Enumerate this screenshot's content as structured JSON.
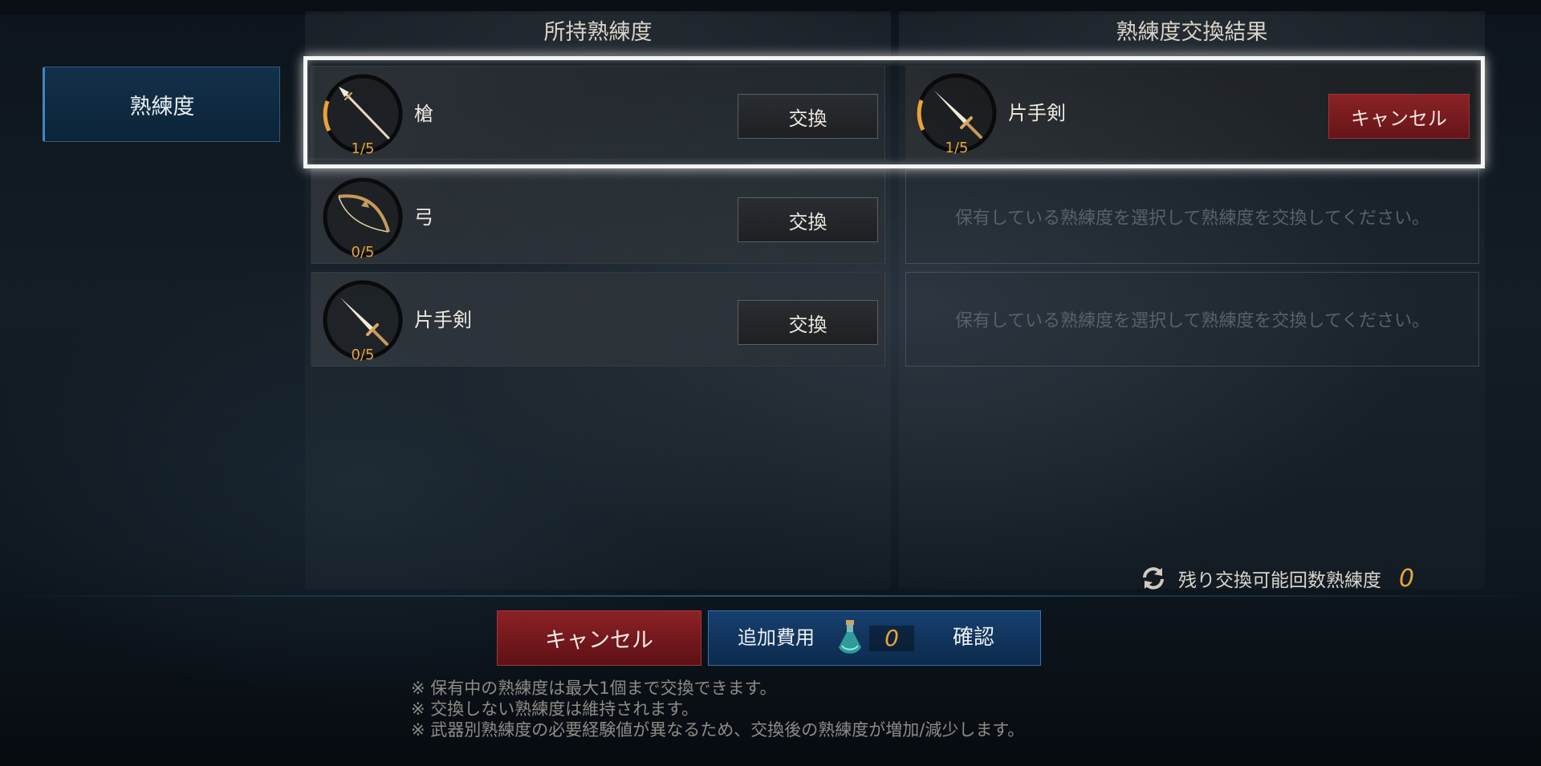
{
  "side_menu": {
    "active_tab": "熟練度"
  },
  "owned_panel": {
    "header": "所持熟練度",
    "items": [
      {
        "name": "槍",
        "count": "1/5",
        "progress": 0.2,
        "icon": "spear-icon",
        "action": "交換"
      },
      {
        "name": "弓",
        "count": "0/5",
        "progress": 0,
        "icon": "bow-icon",
        "action": "交換"
      },
      {
        "name": "片手剣",
        "count": "0/5",
        "progress": 0,
        "icon": "sword-icon",
        "action": "交換"
      }
    ]
  },
  "result_panel": {
    "header": "熟練度交換結果",
    "selected": {
      "name": "片手剣",
      "count": "1/5",
      "progress": 0.2,
      "icon": "sword-icon",
      "cancel_label": "キャンセル"
    },
    "empty_message": "保有している熟練度を選択して熟練度を交換してください。"
  },
  "remaining": {
    "label": "残り交換可能回数熟練度",
    "value": "0",
    "icon": "refresh-icon"
  },
  "footer": {
    "cancel_label": "キャンセル",
    "cost_label": "追加費用",
    "cost_value": "0",
    "cost_icon": "potion-icon",
    "confirm_label": "確認"
  },
  "notes": [
    "※  保有中の熟練度は最大1個まで交換できます。",
    "※  交換しない熟練度は維持されます。",
    "※  武器別熟練度の必要経験値が異なるため、交換後の熟練度が増加/減少します。"
  ],
  "colors": {
    "accent_gold": "#e8a438",
    "cancel_red": "#8c2125",
    "confirm_blue": "#16406e"
  }
}
